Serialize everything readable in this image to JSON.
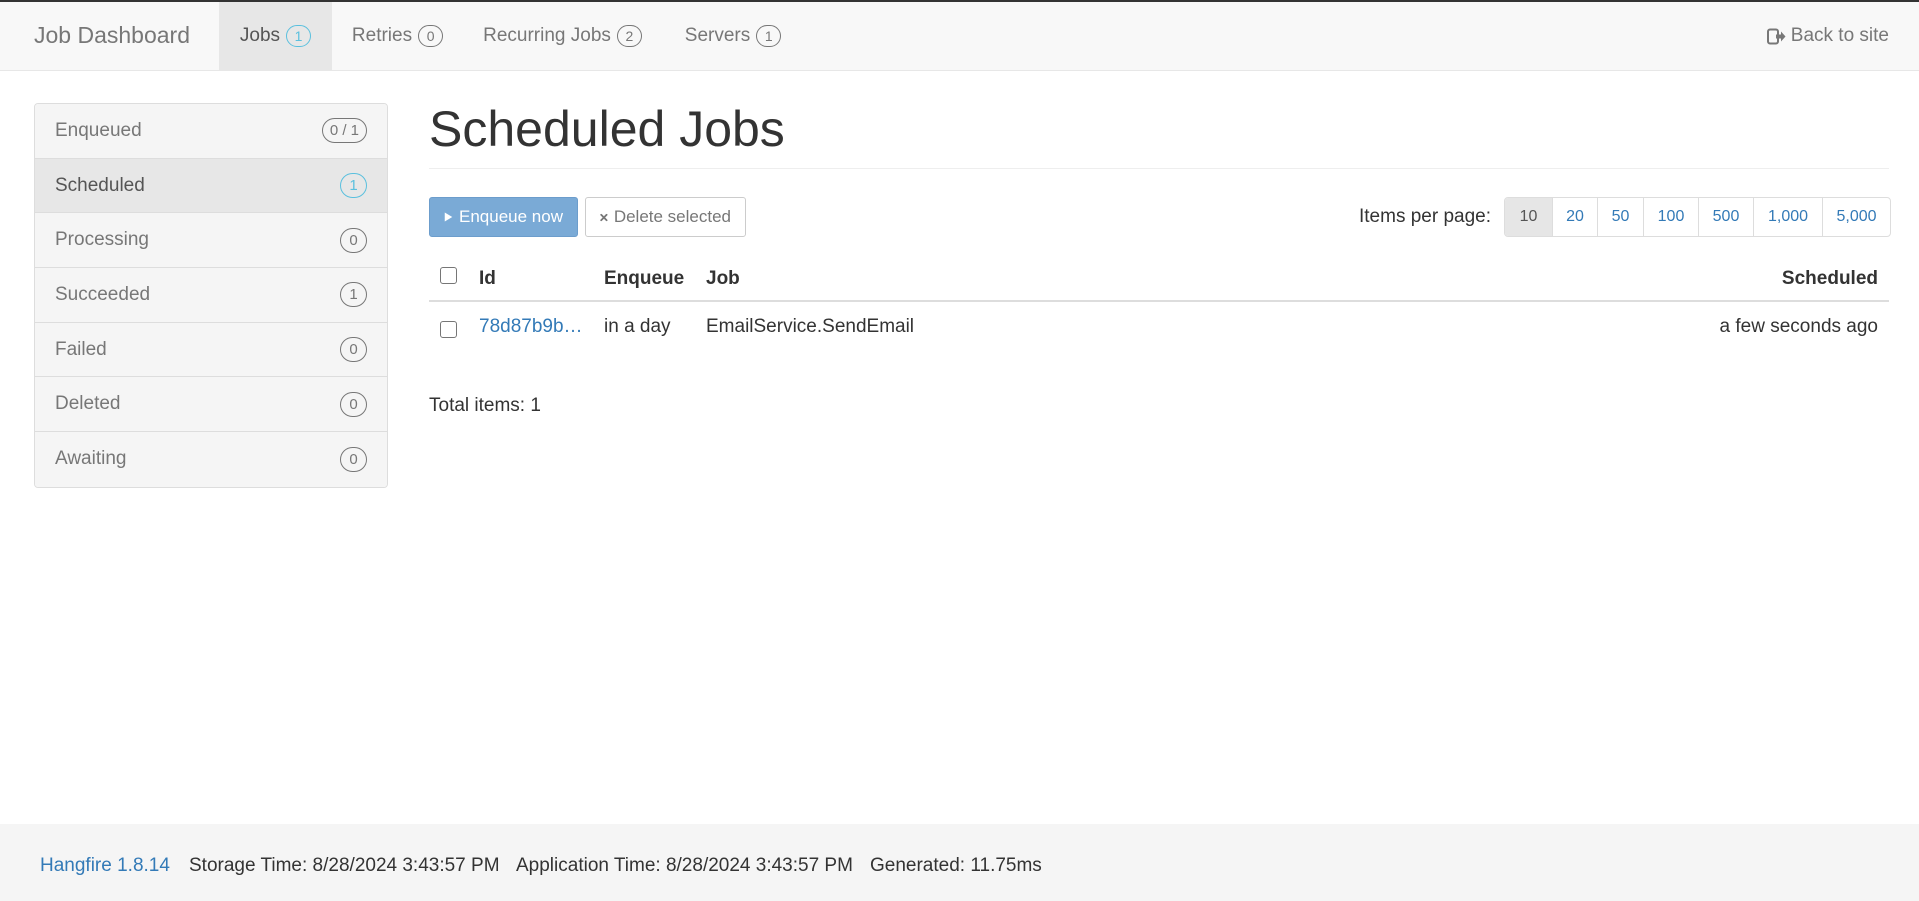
{
  "navbar": {
    "brand": "Job Dashboard",
    "items": [
      {
        "label": "Jobs",
        "count": "1",
        "active": true
      },
      {
        "label": "Retries",
        "count": "0"
      },
      {
        "label": "Recurring Jobs",
        "count": "2"
      },
      {
        "label": "Servers",
        "count": "1"
      }
    ],
    "back_label": "Back to site"
  },
  "sidebar": {
    "items": [
      {
        "label": "Enqueued",
        "count": "0 / 1"
      },
      {
        "label": "Scheduled",
        "count": "1",
        "active": true
      },
      {
        "label": "Processing",
        "count": "0"
      },
      {
        "label": "Succeeded",
        "count": "1"
      },
      {
        "label": "Failed",
        "count": "0"
      },
      {
        "label": "Deleted",
        "count": "0"
      },
      {
        "label": "Awaiting",
        "count": "0"
      }
    ]
  },
  "main": {
    "title": "Scheduled Jobs",
    "enqueue_button": "Enqueue now",
    "delete_button": "Delete selected",
    "items_per_page_label": "Items per page:",
    "page_sizes": [
      "10",
      "20",
      "50",
      "100",
      "500",
      "1,000",
      "5,000"
    ],
    "selected_page_size": "10",
    "table": {
      "columns": [
        "Id",
        "Enqueue",
        "Job",
        "Scheduled"
      ],
      "rows": [
        {
          "id": "78d87b9b…",
          "enqueue": "in a day",
          "job": "EmailService.SendEmail",
          "scheduled": "a few seconds ago"
        }
      ]
    },
    "total_items": "Total items: 1"
  },
  "footer": {
    "version": "Hangfire 1.8.14",
    "storage_time": "Storage Time: 8/28/2024 3:43:57 PM",
    "application_time": "Application Time: 8/28/2024 3:43:57 PM",
    "generated": "Generated: 11.75ms"
  },
  "colors": {
    "link": "#337ab7",
    "primary_button": "#7aaad6",
    "active_badge": "#5bc0de"
  }
}
